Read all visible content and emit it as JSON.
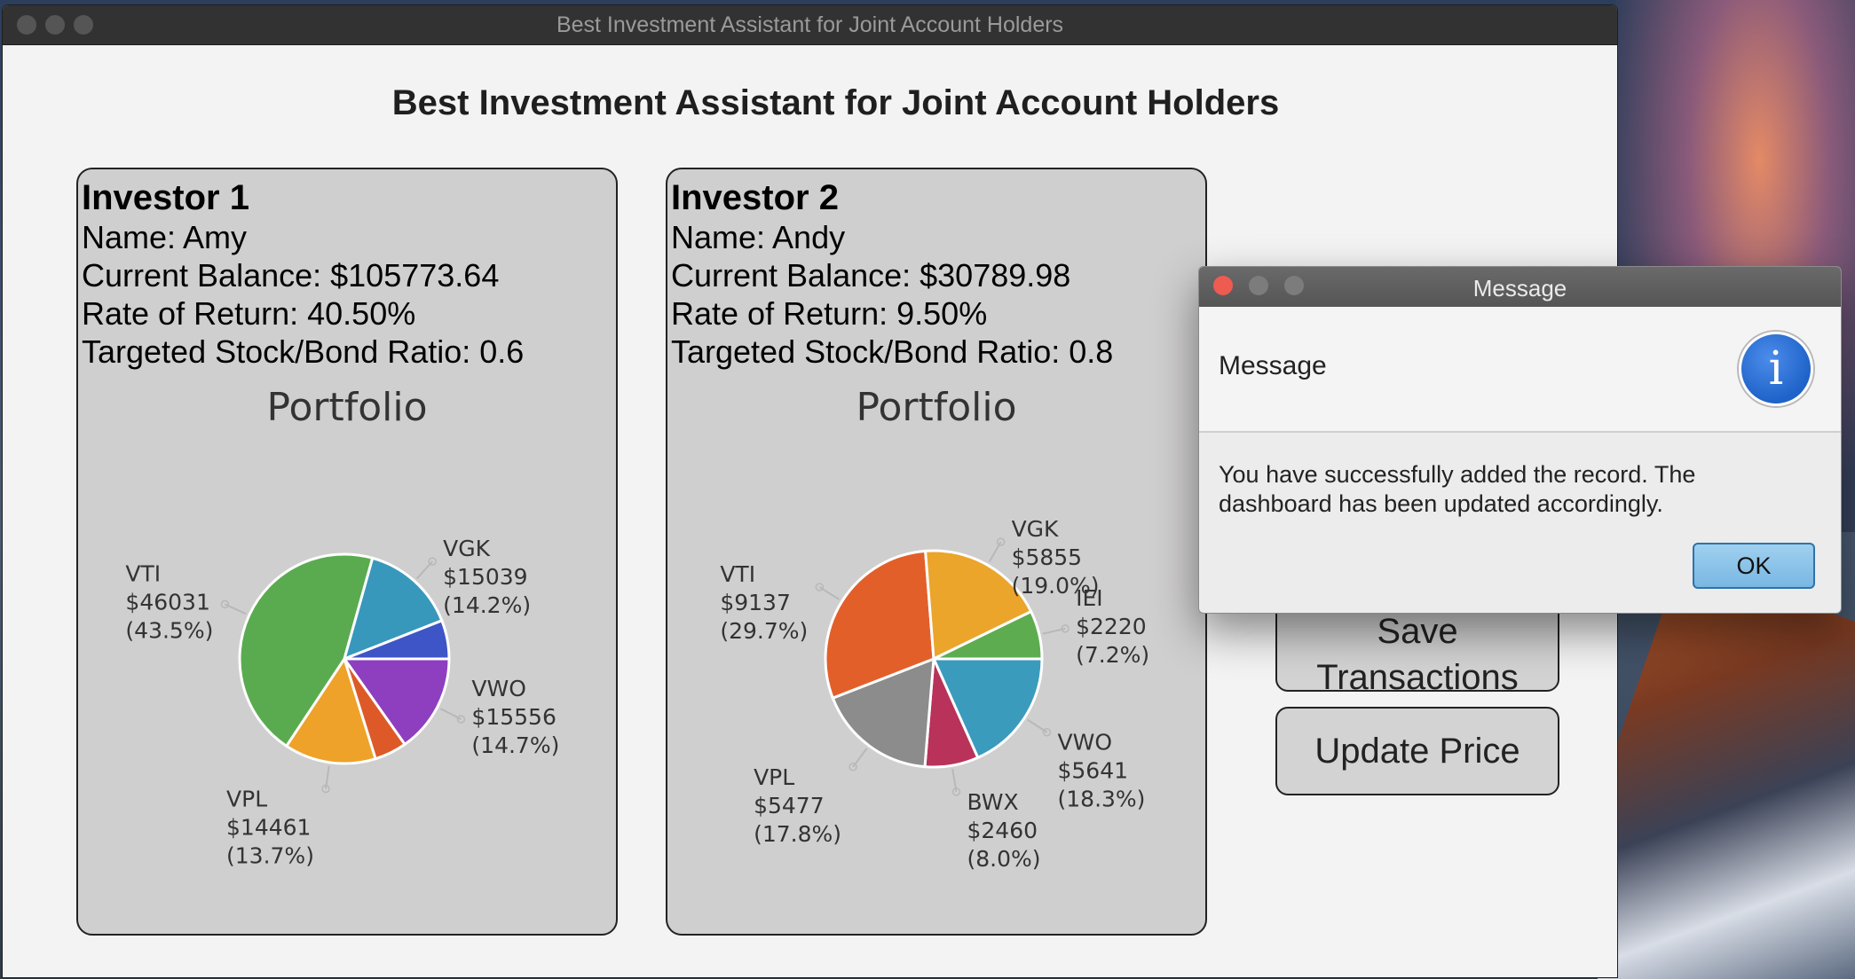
{
  "window": {
    "title": "Best Investment Assistant for Joint Account Holders"
  },
  "header": {
    "title": "Best Investment Assistant for Joint Account Holders"
  },
  "investors": [
    {
      "heading": "Investor 1",
      "name_line": "Name: Amy",
      "balance_line": "Current Balance: $105773.64",
      "return_line": "Rate of Return: 40.50%",
      "ratio_line": "Targeted Stock/Bond Ratio: 0.6",
      "portfolio_title": "Portfolio"
    },
    {
      "heading": "Investor 2",
      "name_line": "Name: Andy",
      "balance_line": "Current Balance: $30789.98",
      "return_line": "Rate of Return: 9.50%",
      "ratio_line": "Targeted Stock/Bond Ratio: 0.8",
      "portfolio_title": "Portfolio"
    }
  ],
  "chart_data": [
    {
      "type": "pie",
      "title": "Portfolio",
      "slices": [
        {
          "name": "VWO",
          "value": 15556,
          "percent": 14.7,
          "color": "#8e3fc0",
          "label_lines": [
            "VWO",
            "$15556",
            "(14.7%)"
          ]
        },
        {
          "name": "",
          "value": 5100,
          "percent": 4.8,
          "color": "#dd5a28",
          "label_lines": []
        },
        {
          "name": "VPL",
          "value": 14461,
          "percent": 13.7,
          "color": "#eea229",
          "label_lines": [
            "VPL",
            "$14461",
            "(13.7%)"
          ]
        },
        {
          "name": "VTI",
          "value": 46031,
          "percent": 43.5,
          "color": "#5aab4f",
          "label_lines": [
            "VTI",
            "$46031",
            "(43.5%)"
          ]
        },
        {
          "name": "VGK",
          "value": 15039,
          "percent": 14.2,
          "color": "#3798bc",
          "label_lines": [
            "VGK",
            "$15039",
            "(14.2%)"
          ]
        },
        {
          "name": "",
          "value": 6100,
          "percent": 5.8,
          "color": "#3d55c6",
          "label_lines": []
        }
      ]
    },
    {
      "type": "pie",
      "title": "Portfolio",
      "slices": [
        {
          "name": "VWO",
          "value": 5641,
          "percent": 18.3,
          "color": "#3b9bbd",
          "label_lines": [
            "VWO",
            "$5641",
            "(18.3%)"
          ]
        },
        {
          "name": "BWX",
          "value": 2460,
          "percent": 8.0,
          "color": "#b8325a",
          "label_lines": [
            "BWX",
            "$2460",
            "(8.0%)"
          ]
        },
        {
          "name": "VPL",
          "value": 5477,
          "percent": 17.8,
          "color": "#8c8c8c",
          "label_lines": [
            "VPL",
            "$5477",
            "(17.8%)"
          ]
        },
        {
          "name": "VTI",
          "value": 9137,
          "percent": 29.7,
          "color": "#e35f2a",
          "label_lines": [
            "VTI",
            "$9137",
            "(29.7%)"
          ]
        },
        {
          "name": "VGK",
          "value": 5855,
          "percent": 19.0,
          "color": "#eba52b",
          "label_lines": [
            "VGK",
            "$5855",
            "(19.0%)"
          ]
        },
        {
          "name": "IEI",
          "value": 2220,
          "percent": 7.2,
          "color": "#5dad50",
          "label_lines": [
            "IEI",
            "$2220",
            "(7.2%)"
          ]
        }
      ]
    }
  ],
  "buttons": {
    "save_line1": "Save",
    "save_line2": "Transactions",
    "update_price": "Update Price"
  },
  "dialog": {
    "title": "Message",
    "header": "Message",
    "icon": "info-icon",
    "icon_glyph": "i",
    "body": "You have successfully added the record. The dashboard has been updated accordingly.",
    "ok_label": "OK"
  }
}
